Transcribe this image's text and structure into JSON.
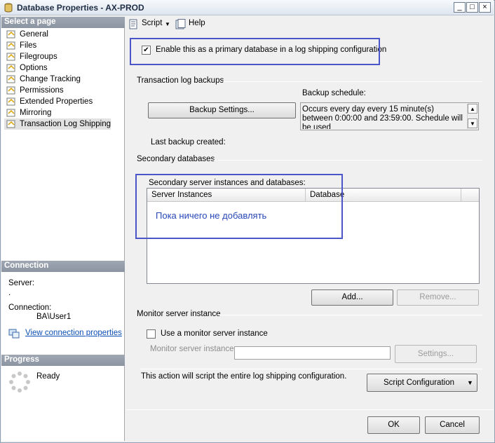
{
  "window": {
    "title": "Database Properties - AX-PROD",
    "min": "_",
    "max": "□",
    "close": "×"
  },
  "left": {
    "select_page_header": "Select a page",
    "pages": [
      {
        "label": "General"
      },
      {
        "label": "Files"
      },
      {
        "label": "Filegroups"
      },
      {
        "label": "Options"
      },
      {
        "label": "Change Tracking"
      },
      {
        "label": "Permissions"
      },
      {
        "label": "Extended Properties"
      },
      {
        "label": "Mirroring"
      },
      {
        "label": "Transaction Log Shipping"
      }
    ],
    "connection_header": "Connection",
    "server_label": "Server:",
    "server_value": ".",
    "connection_label": "Connection:",
    "connection_value": "BA\\User1",
    "view_connection_link": "View connection properties",
    "progress_header": "Progress",
    "progress_status": "Ready"
  },
  "toolbar": {
    "script_label": "Script",
    "dropdown_arrow": "▼",
    "help_label": "Help"
  },
  "main": {
    "enable_primary_label": "Enable this as a primary database in a log shipping configuration",
    "enable_primary_checked": true,
    "check_mark": "✔",
    "tlog_group": "Transaction log backups",
    "backup_settings_button": "Backup Settings...",
    "backup_schedule_label": "Backup schedule:",
    "backup_schedule_text": "Occurs every day every 15 minute(s) between 0:00:00 and 23:59:00. Schedule will be used",
    "scroll_up": "▲",
    "scroll_down": "▼",
    "last_backup_label": "Last backup created:",
    "secondary_group": "Secondary databases",
    "secondary_instances_label": "Secondary server instances and databases:",
    "columns": [
      "Server Instances",
      "Database"
    ],
    "annotation_text": "Пока ничего не добавлять",
    "add_button": "Add...",
    "remove_button": "Remove...",
    "monitor_group": "Monitor server instance",
    "use_monitor_label": "Use a monitor server instance",
    "monitor_instance_label": "Monitor server instance",
    "monitor_instance_value": "",
    "settings_button": "Settings...",
    "script_note": "This action will script the entire log shipping configuration.",
    "script_config_button": "Script Configuration",
    "ok_button": "OK",
    "cancel_button": "Cancel"
  },
  "colors": {
    "annotation": "#4b57c8",
    "link": "#0b4fb5"
  }
}
